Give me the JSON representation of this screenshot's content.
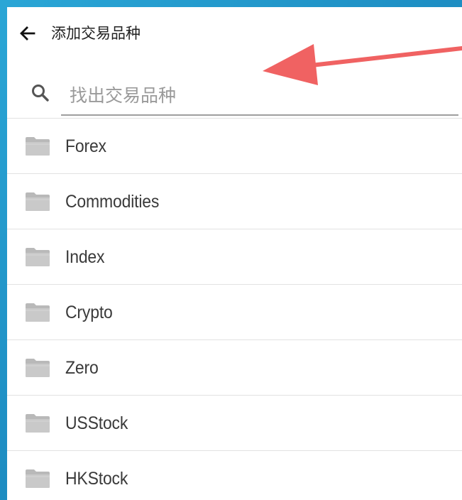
{
  "header": {
    "back_icon": "arrow-left-icon",
    "title": "添加交易品种"
  },
  "search": {
    "icon": "search-icon",
    "placeholder": "找出交易品种",
    "value": ""
  },
  "symbol_folders": {
    "icon": "folder-icon",
    "items": [
      {
        "label": "Forex"
      },
      {
        "label": "Commodities"
      },
      {
        "label": "Index"
      },
      {
        "label": "Crypto"
      },
      {
        "label": "Zero"
      },
      {
        "label": "USStock"
      },
      {
        "label": "HKStock"
      }
    ]
  },
  "annotation": {
    "type": "arrow",
    "color": "#f06262",
    "points_to": "search-input"
  },
  "colors": {
    "background_accent": "#1e8fc4",
    "folder_gray": "#c4c4c4",
    "divider": "#e2e2e2",
    "text": "#3a3a3a"
  }
}
